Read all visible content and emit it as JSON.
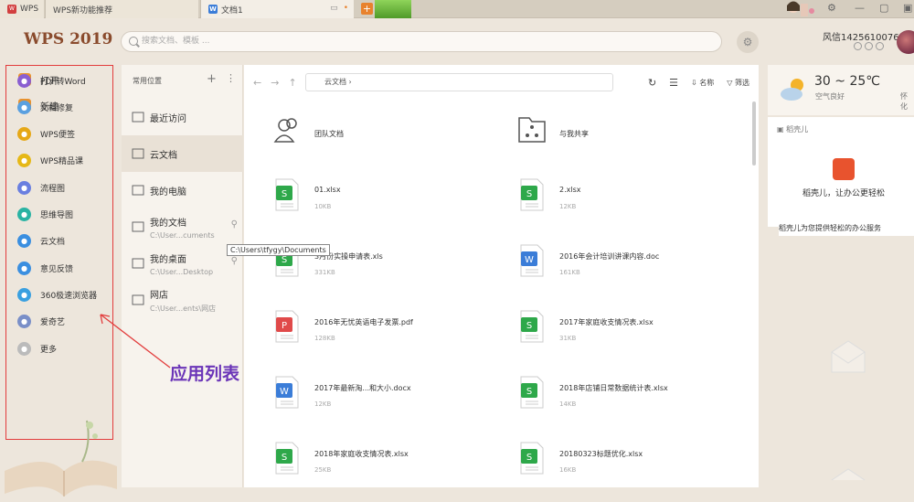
{
  "tabs": {
    "wps": "WPS",
    "new_features": "WPS新功能推荐",
    "doc": "文档1"
  },
  "header": {
    "brand": "WPS 2019",
    "search_placeholder": "搜索文档、模板 ...",
    "username": "风信1425610076"
  },
  "leftnav": {
    "open": "打开",
    "new": "新建"
  },
  "apps": [
    {
      "label": "PDF转Word",
      "color": "#8a5fd1"
    },
    {
      "label": "文档修复",
      "color": "#5aa0e0"
    },
    {
      "label": "WPS便签",
      "color": "#e6a817"
    },
    {
      "label": "WPS精品课",
      "color": "#e6b817"
    },
    {
      "label": "流程图",
      "color": "#6a7fe0"
    },
    {
      "label": "思维导图",
      "color": "#2ab3a3"
    },
    {
      "label": "云文档",
      "color": "#3b8fe0"
    },
    {
      "label": "意见反馈",
      "color": "#3b8fe0"
    },
    {
      "label": "360极速浏览器",
      "color": "#3aa0e0"
    },
    {
      "label": "爱奇艺",
      "color": "#7a8fc8"
    },
    {
      "label": "更多",
      "color": "#bbb"
    }
  ],
  "locations": {
    "header": "常用位置",
    "items": [
      {
        "label": "最近访问",
        "sub": ""
      },
      {
        "label": "云文档",
        "sub": ""
      },
      {
        "label": "我的电脑",
        "sub": ""
      },
      {
        "label": "我的文档",
        "sub": "C:\\User...cuments"
      },
      {
        "label": "我的桌面",
        "sub": "C:\\User...Desktop"
      },
      {
        "label": "网店",
        "sub": "C:\\User...ents\\网店"
      }
    ]
  },
  "tooltip": "C:\\Users\\tfygy\\Documents",
  "toolbar": {
    "breadcrumb": "云文档",
    "sort": "名称",
    "filter": "筛选"
  },
  "files": [
    {
      "name": "团队文档",
      "size": "",
      "type": "team"
    },
    {
      "name": "与我共享",
      "size": "",
      "type": "share"
    },
    {
      "name": "01.xlsx",
      "size": "10KB",
      "type": "xls"
    },
    {
      "name": "2.xlsx",
      "size": "12KB",
      "type": "xls"
    },
    {
      "name": "3月份实操申请表.xls",
      "size": "331KB",
      "type": "xls"
    },
    {
      "name": "2016年会计培训讲课内容.doc",
      "size": "161KB",
      "type": "doc"
    },
    {
      "name": "2016年无忧英语电子发票.pdf",
      "size": "128KB",
      "type": "pdf"
    },
    {
      "name": "2017年家庭收支情况表.xlsx",
      "size": "31KB",
      "type": "xls"
    },
    {
      "name": "2017年最新淘...和大小.docx",
      "size": "12KB",
      "type": "docb"
    },
    {
      "name": "2018年店铺日常数据统计表.xlsx",
      "size": "14KB",
      "type": "xls"
    },
    {
      "name": "2018年家庭收支情况表.xlsx",
      "size": "25KB",
      "type": "xls"
    },
    {
      "name": "20180323标题优化.xlsx",
      "size": "16KB",
      "type": "xls"
    }
  ],
  "weather": {
    "temp": "30 ~ 25℃",
    "desc": "空气良好",
    "extra": "怀化"
  },
  "daoke": {
    "header": "稻壳儿",
    "title": "稻壳儿，让办公更轻松",
    "desc": "稻壳儿为您提供轻松的办公服务"
  },
  "annotation": "应用列表"
}
